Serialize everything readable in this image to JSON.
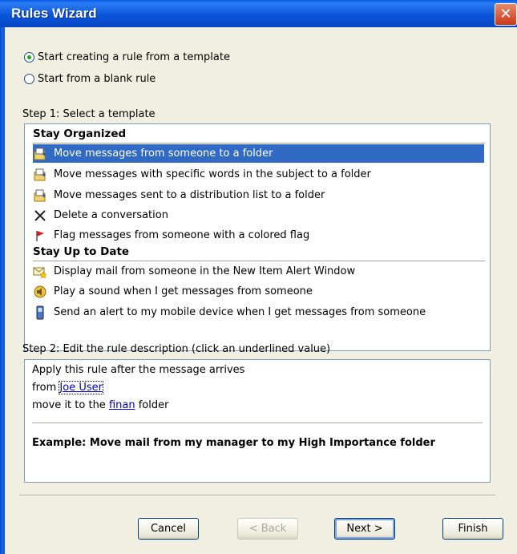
{
  "window": {
    "title": "Rules Wizard",
    "close_symbol": "✕"
  },
  "options": {
    "template_label": "Start creating a rule from a template",
    "blank_label": "Start from a blank rule",
    "selected": "template"
  },
  "step1": {
    "label": "Step 1: Select a template",
    "sections": [
      {
        "header": "Stay Organized",
        "items": [
          {
            "label": "Move messages from someone to a folder",
            "icon": "move-folder-icon",
            "selected": true
          },
          {
            "label": "Move messages with specific words in the subject to a folder",
            "icon": "move-folder-icon"
          },
          {
            "label": "Move messages sent to a distribution list to a folder",
            "icon": "move-folder-icon"
          },
          {
            "label": "Delete a conversation",
            "icon": "delete-x-icon"
          },
          {
            "label": "Flag messages from someone with a colored flag",
            "icon": "red-flag-icon"
          }
        ]
      },
      {
        "header": "Stay Up to Date",
        "items": [
          {
            "label": "Display mail from someone in the New Item Alert Window",
            "icon": "envelope-star-icon"
          },
          {
            "label": "Play a sound when I get messages from someone",
            "icon": "speaker-icon"
          },
          {
            "label": "Send an alert to my mobile device when I get messages from someone",
            "icon": "mobile-device-icon"
          }
        ]
      }
    ]
  },
  "step2": {
    "label": "Step 2: Edit the rule description (click an underlined value)",
    "line1": "Apply this rule after the message arrives",
    "line2_prefix": "from",
    "line2_link": "Joe User",
    "line3_prefix": "move it to the",
    "line3_link": "finan",
    "line3_suffix": "folder",
    "example": "Example: Move mail from my manager to my High Importance folder"
  },
  "buttons": {
    "cancel": "Cancel",
    "back": "< Back",
    "next": "Next >",
    "finish": "Finish"
  },
  "colors": {
    "selection": "#316ac5",
    "titlebar": "#0a55d9",
    "link": "#0000cc"
  }
}
